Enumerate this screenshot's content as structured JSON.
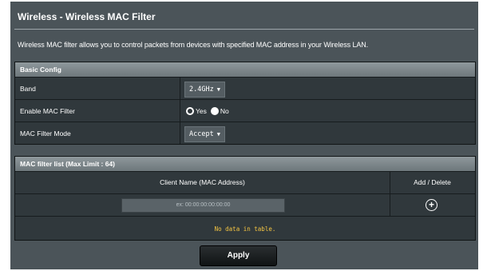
{
  "page": {
    "title": "Wireless - Wireless MAC Filter",
    "description": "Wireless MAC filter allows you to control packets from devices with specified MAC address in your Wireless LAN."
  },
  "basic_config": {
    "header": "Basic Config",
    "band": {
      "label": "Band",
      "value": "2.4GHz"
    },
    "enable_mac_filter": {
      "label": "Enable MAC Filter",
      "yes_label": "Yes",
      "no_label": "No",
      "selected": "No"
    },
    "mac_filter_mode": {
      "label": "MAC Filter Mode",
      "value": "Accept"
    }
  },
  "mac_filter_list": {
    "header": "MAC filter list (Max Limit : 64)",
    "columns": [
      "Client Name (MAC Address)",
      "Add / Delete"
    ],
    "input_placeholder": "ex: 00:00:00:00:00:00",
    "empty_message": "No data in table."
  },
  "actions": {
    "apply_label": "Apply"
  },
  "colors": {
    "panel_bg": "#4b5459",
    "section_bg": "#30383c",
    "empty_text": "#f5c542"
  }
}
